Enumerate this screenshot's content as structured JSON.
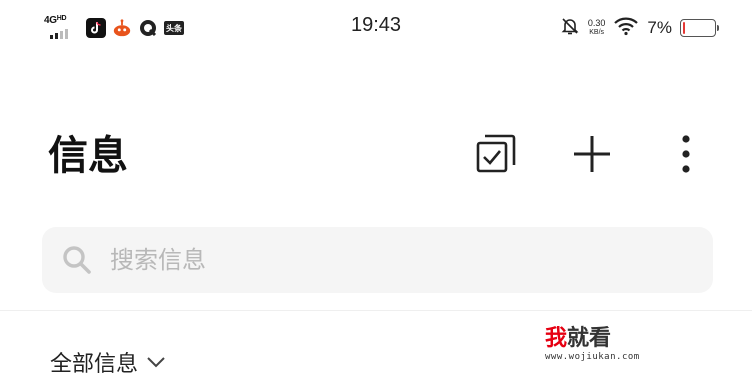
{
  "status_bar": {
    "network": "4G",
    "network_hd": "HD",
    "toutiao_label": "头条",
    "time": "19:43",
    "speed_value": "0.30",
    "speed_unit": "KB/s",
    "battery_percent": "7%",
    "battery_level": 0.07,
    "battery_color": "#e53935",
    "icons": [
      "tiktok-icon",
      "baidu-icon",
      "quark-icon",
      "toutiao-icon",
      "bell-muted-icon",
      "wifi-icon",
      "battery-icon"
    ]
  },
  "header": {
    "title": "信息",
    "icons": [
      "multi-select-icon",
      "plus-icon",
      "more-vertical-icon"
    ]
  },
  "search": {
    "placeholder": "搜索信息",
    "icon": "search-icon"
  },
  "filter": {
    "label": "全部信息",
    "icon": "chevron-down-icon"
  },
  "watermark": {
    "brand_red": "我",
    "brand_rest": "就看",
    "url": "www.wojiukan.com"
  }
}
